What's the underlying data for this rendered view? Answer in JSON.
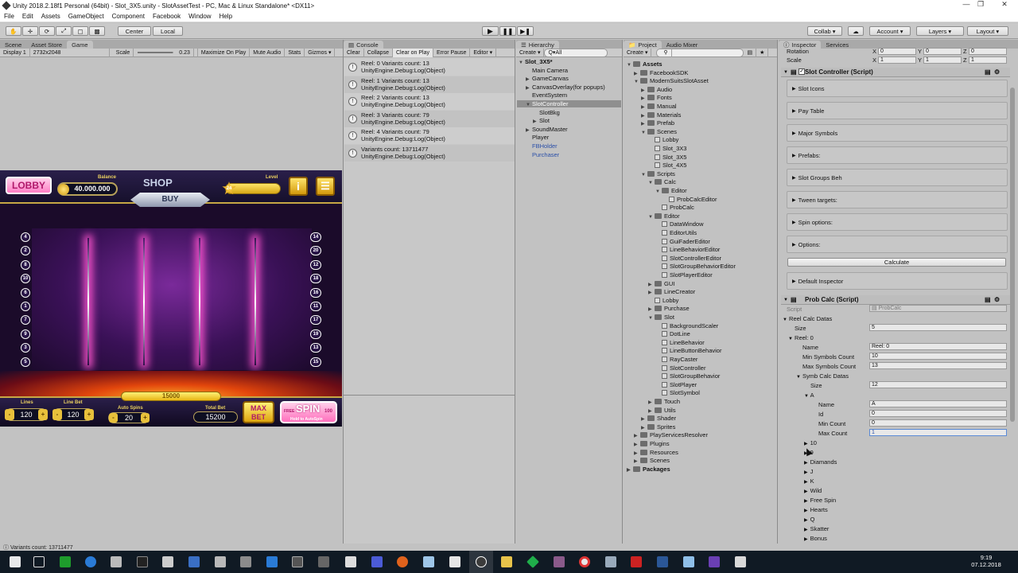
{
  "window": {
    "title": "Unity 2018.2.18f1 Personal (64bit) - Slot_3X5.unity - SlotAssetTest - PC, Mac & Linux Standalone* <DX11>"
  },
  "menu": [
    "File",
    "Edit",
    "Assets",
    "GameObject",
    "Component",
    "Facebook",
    "Window",
    "Help"
  ],
  "toolbar": {
    "center": "Center",
    "local": "Local",
    "collab": "Collab ▾",
    "account": "Account",
    "layers": "Layers",
    "layout": "Layout"
  },
  "scene_panel": {
    "tabs": [
      "Scene",
      "Asset Store",
      "Game"
    ],
    "display": "Display 1",
    "resolution": "2732x2048",
    "scale_label": "Scale",
    "scale_value": "0.23",
    "options": [
      "Maximize On Play",
      "Mute Audio",
      "Stats",
      "Gizmos ▾"
    ]
  },
  "game": {
    "lobby": "LOBBY",
    "balance_label": "Balance",
    "balance": "40.000.000",
    "shop": "SHOP",
    "buy": "BUY",
    "level_label": "Level",
    "level": "24",
    "left_lines": [
      "4",
      "2",
      "8",
      "10",
      "6",
      "1",
      "7",
      "9",
      "3",
      "5"
    ],
    "right_lines": [
      "14",
      "20",
      "12",
      "18",
      "16",
      "11",
      "17",
      "19",
      "13",
      "15"
    ],
    "win": "15000",
    "lines_label": "Lines",
    "lines": "120",
    "linebet_label": "Line Bet",
    "linebet": "120",
    "autospins_label": "Auto Spins",
    "autospins": "20",
    "totalbet_label": "Total Bet",
    "totalbet": "15200",
    "maxbet": "MAX BET",
    "free": "FREE",
    "spin": "SPIN",
    "spin_count": "100",
    "hold": "Hold to AutoSpin"
  },
  "console": {
    "tab": "Console",
    "buttons": [
      "Clear",
      "Collapse",
      "Clear on Play",
      "Error Pause",
      "Editor ▾"
    ],
    "entries": [
      {
        "line1": "Reel: 0 Variants count: 13",
        "line2": "UnityEngine.Debug:Log(Object)"
      },
      {
        "line1": "Reel: 1 Variants count: 13",
        "line2": "UnityEngine.Debug:Log(Object)"
      },
      {
        "line1": "Reel: 2 Variants count: 13",
        "line2": "UnityEngine.Debug:Log(Object)"
      },
      {
        "line1": "Reel: 3 Variants count: 79",
        "line2": "UnityEngine.Debug:Log(Object)"
      },
      {
        "line1": "Reel: 4 Variants count: 79",
        "line2": "UnityEngine.Debug:Log(Object)"
      },
      {
        "line1": "Variants count: 13711477",
        "line2": "UnityEngine.Debug:Log(Object)"
      }
    ]
  },
  "hierarchy": {
    "tab": "Hierarchy",
    "create": "Create ▾",
    "search": "Q▾All",
    "items": [
      {
        "label": "Slot_3X5*",
        "depth": 0
      },
      {
        "label": "Main Camera",
        "depth": 1
      },
      {
        "label": "GameCanvas",
        "depth": 1
      },
      {
        "label": "CanvasOverlay(for popups)",
        "depth": 1
      },
      {
        "label": "EventSystem",
        "depth": 1
      },
      {
        "label": "SlotController",
        "depth": 1
      },
      {
        "label": "SlotBkg",
        "depth": 2
      },
      {
        "label": "Slot",
        "depth": 2
      },
      {
        "label": "SoundMaster",
        "depth": 1
      },
      {
        "label": "Player",
        "depth": 1
      },
      {
        "label": "FBHolder",
        "depth": 1
      },
      {
        "label": "Purchaser",
        "depth": 1
      }
    ]
  },
  "project": {
    "tabs": [
      "Project",
      "Audio Mixer"
    ],
    "create": "Create ▾",
    "items": [
      {
        "label": "Assets",
        "depth": 0
      },
      {
        "label": "FacebookSDK",
        "depth": 1
      },
      {
        "label": "ModernSuitsSlotAsset",
        "depth": 1
      },
      {
        "label": "Audio",
        "depth": 2
      },
      {
        "label": "Fonts",
        "depth": 2
      },
      {
        "label": "Manual",
        "depth": 2
      },
      {
        "label": "Materials",
        "depth": 2
      },
      {
        "label": "Prefab",
        "depth": 2
      },
      {
        "label": "Scenes",
        "depth": 2
      },
      {
        "label": "Lobby",
        "depth": 3
      },
      {
        "label": "Slot_3X3",
        "depth": 3
      },
      {
        "label": "Slot_3X5",
        "depth": 3
      },
      {
        "label": "Slot_4X5",
        "depth": 3
      },
      {
        "label": "Scripts",
        "depth": 2
      },
      {
        "label": "Calc",
        "depth": 3
      },
      {
        "label": "Editor",
        "depth": 4
      },
      {
        "label": "ProbCalcEditor",
        "depth": 5
      },
      {
        "label": "ProbCalc",
        "depth": 4
      },
      {
        "label": "Editor",
        "depth": 3
      },
      {
        "label": "DataWindow",
        "depth": 4
      },
      {
        "label": "EditorUtils",
        "depth": 4
      },
      {
        "label": "GuiFaderEditor",
        "depth": 4
      },
      {
        "label": "LineBehaviorEditor",
        "depth": 4
      },
      {
        "label": "SlotControllerEditor",
        "depth": 4
      },
      {
        "label": "SlotGroupBehaviorEditor",
        "depth": 4
      },
      {
        "label": "SlotPlayerEditor",
        "depth": 4
      },
      {
        "label": "GUI",
        "depth": 3
      },
      {
        "label": "LineCreator",
        "depth": 3
      },
      {
        "label": "Lobby",
        "depth": 3
      },
      {
        "label": "Purchase",
        "depth": 3
      },
      {
        "label": "Slot",
        "depth": 3
      },
      {
        "label": "BackgroundScaler",
        "depth": 4
      },
      {
        "label": "DotLine",
        "depth": 4
      },
      {
        "label": "LineBehavior",
        "depth": 4
      },
      {
        "label": "LineButtonBehavior",
        "depth": 4
      },
      {
        "label": "RayCaster",
        "depth": 4
      },
      {
        "label": "SlotController",
        "depth": 4
      },
      {
        "label": "SlotGroupBehavior",
        "depth": 4
      },
      {
        "label": "SlotPlayer",
        "depth": 4
      },
      {
        "label": "SlotSymbol",
        "depth": 4
      },
      {
        "label": "Touch",
        "depth": 3
      },
      {
        "label": "Utils",
        "depth": 3
      },
      {
        "label": "Shader",
        "depth": 2
      },
      {
        "label": "Sprites",
        "depth": 2
      },
      {
        "label": "PlayServicesResolver",
        "depth": 1
      },
      {
        "label": "Plugins",
        "depth": 1
      },
      {
        "label": "Resources",
        "depth": 1
      },
      {
        "label": "Scenes",
        "depth": 1
      },
      {
        "label": "Packages",
        "depth": 0
      }
    ]
  },
  "inspector": {
    "tabs": [
      "Inspector",
      "Services"
    ],
    "rotation": "Rotation",
    "scale": "Scale",
    "rot": {
      "x": "0",
      "y": "0",
      "z": "0"
    },
    "scl": {
      "x": "1",
      "y": "1",
      "z": "1"
    },
    "slot_controller": "Slot Controller (Script)",
    "sections": [
      "Slot Icons",
      "Pay Table",
      "Major Symbols",
      "Prefabs:",
      "Slot Groups Beh",
      "Tween targets:",
      "Spin options:",
      "Options:"
    ],
    "calculate": "Calculate",
    "default_inspector": "Default Inspector",
    "prob_calc": "Prob Calc (Script)",
    "script_label": "Script",
    "script_value": "ProbCalc",
    "reel_calc_datas": "Reel Calc Datas",
    "size_label": "Size",
    "size_value": "5",
    "reel0": "Reel: 0",
    "name_label": "Name",
    "name_value": "Reel: 0",
    "min_label": "Min Symbols Count",
    "min_value": "10",
    "max_label": "Max Symbols Count",
    "max_value": "13",
    "symb_calc": "Symb Calc Datas",
    "symb_size_label": "Size",
    "symb_size_value": "12",
    "sym_a": "A",
    "a_name_label": "Name",
    "a_name_value": "A",
    "a_id_label": "Id",
    "a_id_value": "0",
    "a_min_label": "Min Count",
    "a_min_value": "0",
    "a_max_label": "Max Count",
    "a_max_value": "1",
    "symbols": [
      "10",
      "9",
      "Diamands",
      "J",
      "K",
      "Wild",
      "Free Spin",
      "Hearts",
      "Q",
      "Skatter",
      "Bonus"
    ]
  },
  "status": "Variants count: 13711477",
  "clock": {
    "time": "9:19",
    "date": "07.12.2018"
  }
}
